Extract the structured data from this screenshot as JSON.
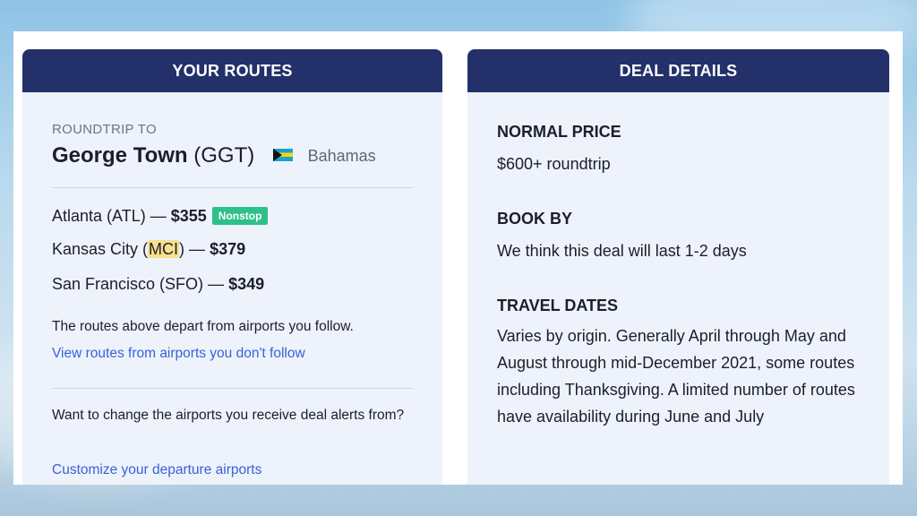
{
  "routes_panel": {
    "header": "YOUR ROUTES",
    "eyebrow": "ROUNDTRIP TO",
    "destination": {
      "city": "George Town",
      "code": "(GGT)",
      "flag_icon": "bahamas-flag-icon",
      "country": "Bahamas"
    },
    "routes": [
      {
        "origin_prefix": "Atlanta (ATL)",
        "dash": " — ",
        "price": "$355",
        "badge": "Nonstop"
      },
      {
        "origin_prefix": "Kansas City (",
        "origin_code": "MCI",
        "origin_suffix": ")",
        "dash": " — ",
        "price": "$379"
      },
      {
        "origin_prefix": "San Francisco (SFO)",
        "dash": " — ",
        "price": "$349"
      }
    ],
    "follow_note": "The routes above depart from airports you follow.",
    "view_link": "View routes from airports you don't follow",
    "change_note": "Want to change the airports you receive deal alerts from?",
    "customize_link": "Customize your departure airports"
  },
  "deal_panel": {
    "header": "DEAL DETAILS",
    "normal_price_label": "NORMAL PRICE",
    "normal_price_value": "$600+ roundtrip",
    "book_by_label": "BOOK BY",
    "book_by_value": "We think this deal will last 1-2 days",
    "travel_dates_label": "TRAVEL DATES",
    "travel_dates_value": "Varies by origin. Generally April through May and August through mid-December 2021, some routes including Thanksgiving. A limited number of routes have availability during June and July"
  },
  "colors": {
    "header_bg": "#23306a",
    "panel_bg": "#eef2fb",
    "link": "#3563d6",
    "badge": "#2fc089",
    "highlight": "#f8df8c"
  }
}
